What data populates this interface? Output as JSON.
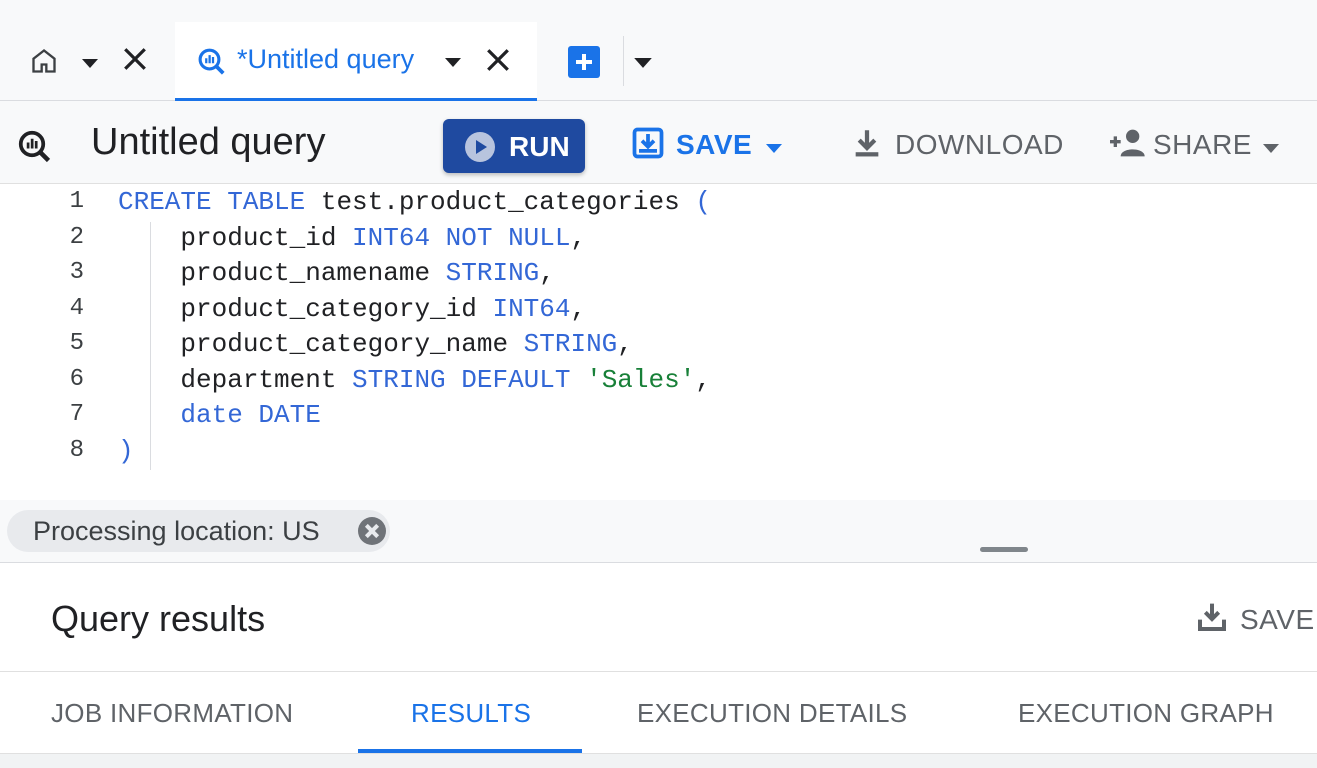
{
  "tabs": {
    "home_tab": {
      "icon": "home-icon"
    },
    "query_tab": {
      "label": "*Untitled query",
      "icon": "query-icon"
    },
    "colors": {
      "accent": "#1a73e8"
    }
  },
  "toolbar": {
    "title": "Untitled query",
    "run_label": "RUN",
    "save_label": "SAVE",
    "download_label": "DOWNLOAD",
    "share_label": "SHARE",
    "run_color": "#1f4aa0"
  },
  "editor": {
    "line_numbers": [
      "1",
      "2",
      "3",
      "4",
      "5",
      "6",
      "7",
      "8"
    ],
    "lines": [
      {
        "parts": [
          "CREATE TABLE",
          " test.product_categories ",
          "("
        ]
      },
      {
        "parts": [
          "    product_id ",
          "INT64 NOT NULL",
          ","
        ]
      },
      {
        "parts": [
          "    product_namename ",
          "STRING",
          ","
        ]
      },
      {
        "parts": [
          "    product_category_id ",
          "INT64",
          ","
        ]
      },
      {
        "parts": [
          "    product_category_name ",
          "STRING",
          ","
        ]
      },
      {
        "parts": [
          "    department ",
          "STRING DEFAULT ",
          "'Sales'",
          ","
        ]
      },
      {
        "parts": [
          "    date DATE"
        ]
      },
      {
        "parts": [
          ")"
        ]
      }
    ],
    "colors": {
      "keyword": "#3367d6",
      "string": "#188038"
    }
  },
  "status": {
    "processing_location": "Processing location: US"
  },
  "results": {
    "title": "Query results",
    "save_label": "SAVE",
    "tabs": [
      {
        "label": "JOB INFORMATION",
        "active": false
      },
      {
        "label": "RESULTS",
        "active": true
      },
      {
        "label": "EXECUTION DETAILS",
        "active": false
      },
      {
        "label": "EXECUTION GRAPH",
        "active": false
      }
    ]
  }
}
